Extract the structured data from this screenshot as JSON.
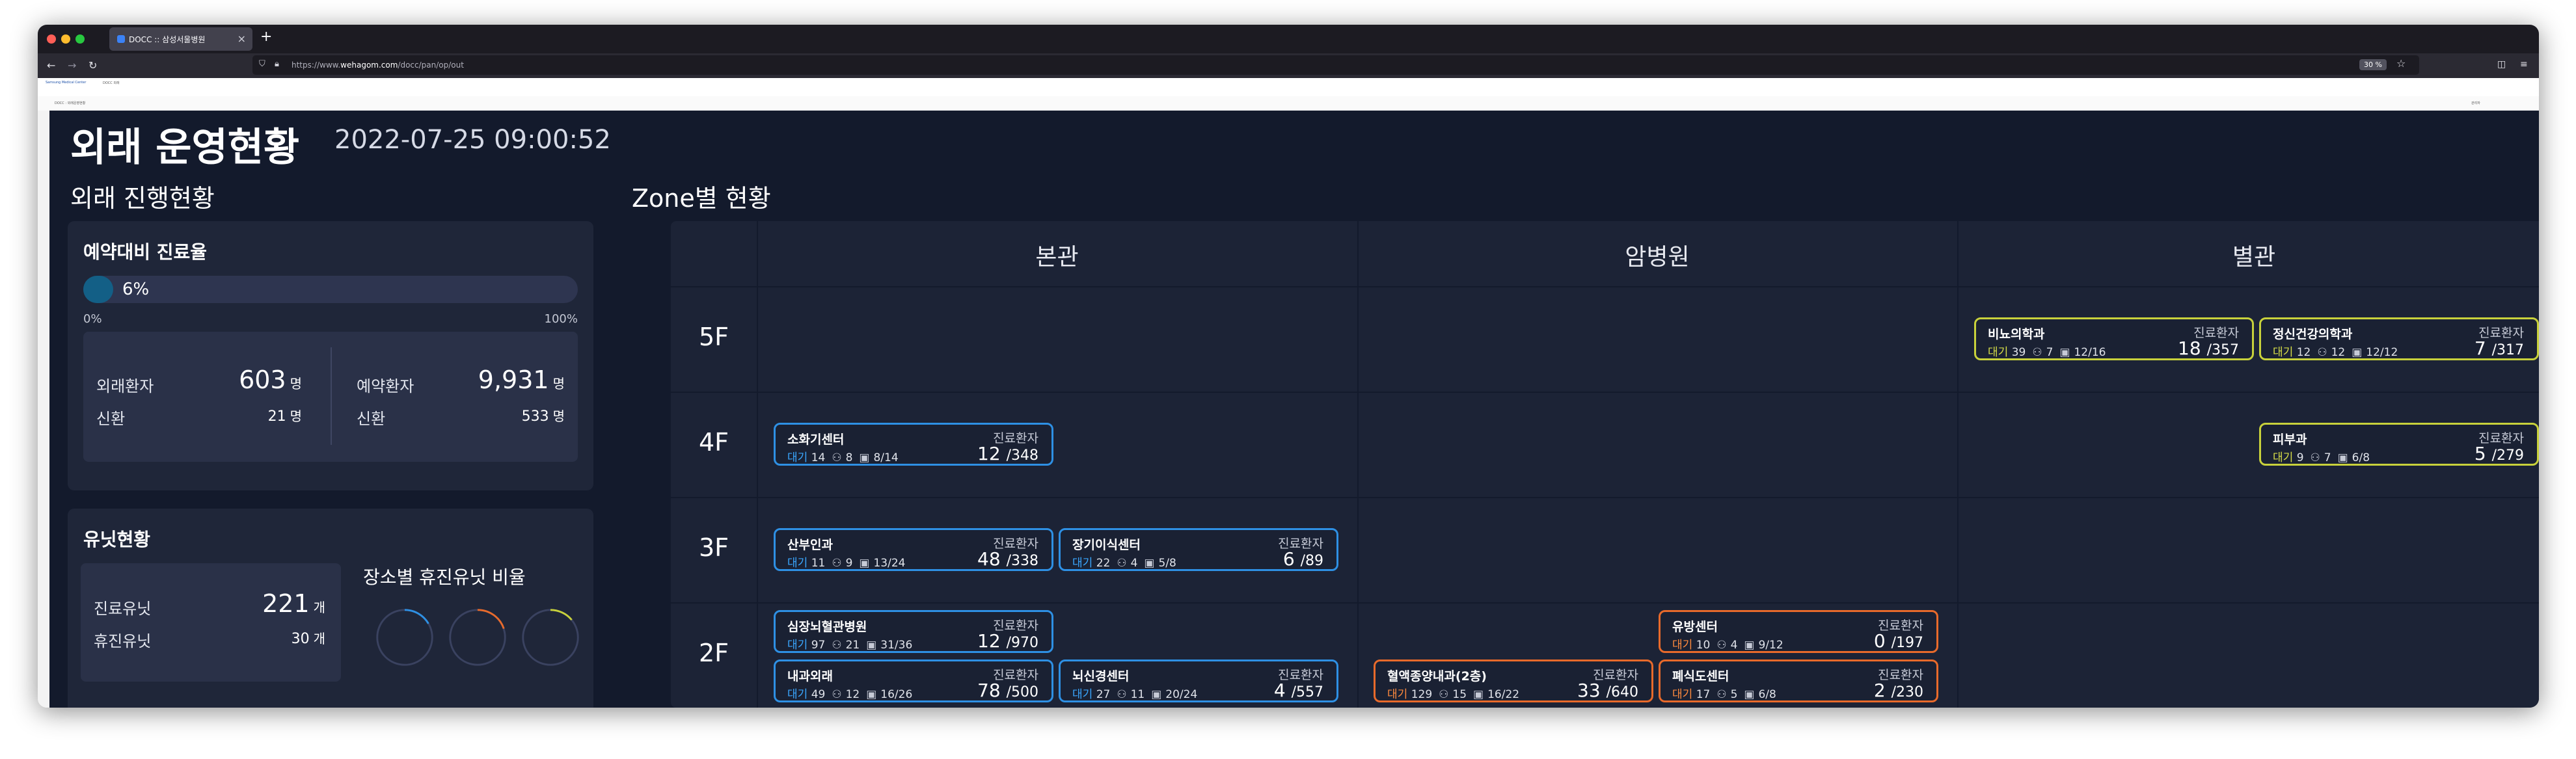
{
  "browser": {
    "tab_title": "DOCC :: 삼성서울병원",
    "url_prefix": "https://www.",
    "url_domain": "wehagom.com",
    "url_path": "/docc/pan/op/out",
    "zoom": "30 %",
    "bookmark": "Samsung Medical Center",
    "bookmark2": "DOCC 외래",
    "subbar_left": "DOCC : 외래운영현황",
    "subbar_right": "관리자"
  },
  "header": {
    "title": "외래 운영현황",
    "datetime": "2022-07-25 09:00:52"
  },
  "left": {
    "section_title": "외래 진행현황",
    "reservation": {
      "title": "예약대비 진료율",
      "percent": "6%",
      "progress_fraction": 0.06,
      "min_label": "0%",
      "max_label": "100%",
      "outpatient_label": "외래환자",
      "outpatient_value": "603",
      "outpatient_unit": "명",
      "new_label": "신환",
      "outpatient_new": "21",
      "new_unit": "명",
      "reserved_label": "예약환자",
      "reserved_value": "9,931",
      "reserved_unit": "명",
      "reserved_new": "533"
    },
    "unit": {
      "title": "유닛현황",
      "treat_label": "진료유닛",
      "treat_value": "221",
      "treat_unit": "개",
      "idle_label": "휴진유닛",
      "idle_value": "30",
      "idle_unit": "개",
      "ratio_title": "장소별 휴진유닛 비율",
      "donut_colors": [
        "#2e90e4",
        "#e86a2b",
        "#c8d13b"
      ]
    }
  },
  "zone": {
    "title": "Zone별 현황",
    "buildings": [
      "본관",
      "암병원",
      "별관"
    ],
    "floors": [
      "5F",
      "4F",
      "3F",
      "2F"
    ],
    "patients_header": "진료환자",
    "wait_label": "대기",
    "colors": {
      "main": "#2e90e4",
      "cancer": "#e86a2b",
      "annex": "#c8d13b"
    },
    "depts": {
      "neuro": {
        "name": "비뇨의학과",
        "wait": "39",
        "people": "7",
        "rooms": "12/16",
        "current": "18",
        "total": "/357"
      },
      "psych": {
        "name": "정신건강의학과",
        "wait": "12",
        "people": "12",
        "rooms": "12/12",
        "current": "7",
        "total": "/317"
      },
      "gastro": {
        "name": "소화기센터",
        "wait": "14",
        "people": "8",
        "rooms": "8/14",
        "current": "12",
        "total": "/348"
      },
      "derm": {
        "name": "피부과",
        "wait": "9",
        "people": "7",
        "rooms": "6/8",
        "current": "5",
        "total": "/279"
      },
      "obgyn": {
        "name": "산부인과",
        "wait": "11",
        "people": "9",
        "rooms": "13/24",
        "current": "48",
        "total": "/338"
      },
      "transplant": {
        "name": "장기이식센터",
        "wait": "22",
        "people": "4",
        "rooms": "5/8",
        "current": "6",
        "total": "/89"
      },
      "cardio": {
        "name": "심장뇌혈관병원",
        "wait": "97",
        "people": "21",
        "rooms": "31/36",
        "current": "12",
        "total": "/970"
      },
      "internal": {
        "name": "내과외래",
        "wait": "49",
        "people": "12",
        "rooms": "16/26",
        "current": "78",
        "total": "/500"
      },
      "neurology": {
        "name": "뇌신경센터",
        "wait": "27",
        "people": "11",
        "rooms": "20/24",
        "current": "4",
        "total": "/557"
      },
      "breast": {
        "name": "유방센터",
        "wait": "10",
        "people": "4",
        "rooms": "9/12",
        "current": "0",
        "total": "/197"
      },
      "hemato": {
        "name": "혈액종양내과(2층)",
        "wait": "129",
        "people": "15",
        "rooms": "16/22",
        "current": "33",
        "total": "/640"
      },
      "lung": {
        "name": "폐식도센터",
        "wait": "17",
        "people": "5",
        "rooms": "6/8",
        "current": "2",
        "total": "/230"
      }
    }
  }
}
